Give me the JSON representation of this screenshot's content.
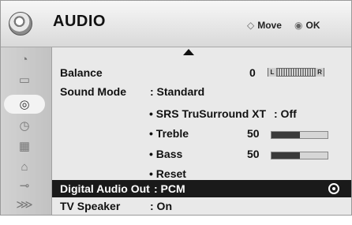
{
  "header": {
    "title": "AUDIO",
    "move_label": "Move",
    "ok_label": "OK",
    "move_symbol": "◇",
    "ok_symbol": "◉"
  },
  "sidebar": {
    "items": [
      {
        "name": "picture-icon",
        "glyph": "◔",
        "active": false
      },
      {
        "name": "screen-icon",
        "glyph": "▭",
        "active": false
      },
      {
        "name": "audio-icon",
        "glyph": "◎",
        "active": true
      },
      {
        "name": "time-icon",
        "glyph": "◷",
        "active": false
      },
      {
        "name": "option-icon",
        "glyph": "▦",
        "active": false
      },
      {
        "name": "lock-icon",
        "glyph": "⌂",
        "active": false
      },
      {
        "name": "input-icon",
        "glyph": "⊸",
        "active": false
      },
      {
        "name": "usb-icon",
        "glyph": "⋙",
        "active": false
      }
    ]
  },
  "menu": {
    "balance": {
      "label": "Balance",
      "value": "0",
      "l": "L",
      "r": "R"
    },
    "sound_mode": {
      "label": "Sound Mode",
      "value": ": Standard"
    },
    "srs": {
      "label": "• SRS TruSurround XT",
      "value": ": Off"
    },
    "treble": {
      "label": "• Treble",
      "value": "50",
      "level": 0.5
    },
    "bass": {
      "label": "• Bass",
      "value": "50",
      "level": 0.5
    },
    "reset": {
      "label": "• Reset"
    },
    "digital_audio_out": {
      "label": "Digital Audio Out",
      "value": ": PCM"
    },
    "tv_speaker": {
      "label": "TV Speaker",
      "value": ": On"
    }
  }
}
